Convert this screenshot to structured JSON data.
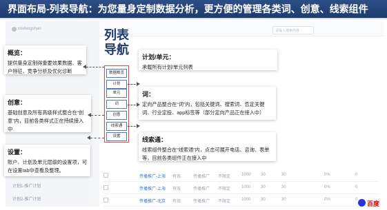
{
  "header": {
    "title": "界面布局-列表导航：为您量身定制数据分析，更方便的管理各类词、创意、线索组件"
  },
  "background_app": {
    "brand": "xxxfengshan",
    "search_placeholder": "请输入搜索内容",
    "sidebar_items": [
      "计划列表",
      "单元列表",
      "词列表",
      "创意列表",
      "线索通",
      "设置",
      "计划1-推广计划",
      "计划2-推广计划"
    ],
    "table_rows": [
      {
        "name": "传播推广-上海",
        "s1": "有效",
        "s2": "传播推广",
        "s3": "不限定",
        "v1": "1000",
        "v2": "30",
        "v3": "30",
        "v4": "0%",
        "v5": "0"
      },
      {
        "name": "传播推广-上海",
        "s1": "有效",
        "s2": "传播推广",
        "s3": "不限定",
        "v1": "1000",
        "v2": "30",
        "v3": "30",
        "v4": "0%",
        "v5": "0"
      },
      {
        "name": "传播推广-北京",
        "s1": "有效",
        "s2": "传播推广",
        "s3": "不限定",
        "v1": "1000",
        "v2": "30",
        "v3": "30",
        "v4": "0%",
        "v5": "0"
      }
    ]
  },
  "big_label": {
    "line1": "列表",
    "line2": "导航"
  },
  "nav": {
    "items": [
      "数据概览",
      "计划",
      "单元",
      "词",
      "创意",
      "线索通",
      "设置"
    ]
  },
  "panels": {
    "overview": {
      "title": "概览：",
      "text": "提供量身定制得重要效果数据、客户特征、竞争分析及优化诊断"
    },
    "creative": {
      "title": "创意：",
      "text": "基础创意及所有高级样式整合在“创意”内，目前各类样式正在持续接入中"
    },
    "settings": {
      "title": "设置：",
      "text": "账户、计划及单元层级的设置项，可在设置tab中查看及整理。"
    },
    "plan_unit": {
      "title": "计划/单元：",
      "text": "承载所有计划/单元列表"
    },
    "words": {
      "title": "词：",
      "text": "定向产品整合在“词”内，包括关键词、搜索词、否定关键词、行业定投、app标签等（部分定向产品正在接入中）"
    },
    "leads": {
      "title": "线索通：",
      "text": "线索组件整合在“线索通”内，点击可展开电话、咨询、表单等，目前各类组件正在接入中"
    }
  },
  "footer": {
    "logo_text": "百度"
  },
  "colors": {
    "header_bg": "#1f3b6d",
    "accent_red": "#e34a3a",
    "accent_blue": "#4c78c4"
  }
}
